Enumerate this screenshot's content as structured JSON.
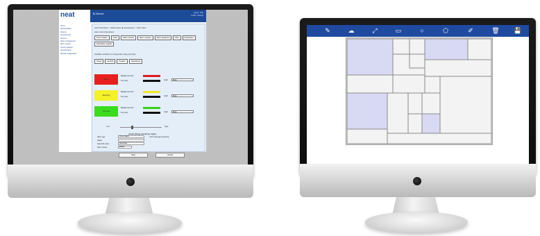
{
  "left_screen": {
    "logo": "neat",
    "header_title": "B-Server",
    "header_links": [
      "Logout",
      "Help",
      "Profile",
      "Settings"
    ],
    "nav_items": [
      "Home",
      "Administration",
      "Options",
      "Users/Groups",
      "Devices",
      "Alarm management",
      "Alarm system",
      "System settings",
      "Administration",
      "Manual configuration"
    ],
    "top_text": "Alarm/Call Status  ○ Default Alarm  ◉ Special alarm  ○ Other alarm",
    "sub_text": "Alarm call configurations",
    "buttons_row1": [
      "Time of alarm",
      "Color",
      "Alarm sounds",
      "Alarm manuav",
      "Alarm telephone",
      "Plan",
      "Destination"
    ],
    "buttons_row2": [
      "Destination register"
    ],
    "mid_text": "Available variables for configuration (drag and drop)",
    "buttons_row3": [
      "Group",
      "Zone/ID",
      "Position",
      "Operational"
    ],
    "alarm_rows": [
      {
        "name": "Alarm",
        "color": "#e82020",
        "bg_label": "Background color",
        "text_label": "Text color",
        "bar1": "#e21b1b",
        "bar2": "#111111"
      },
      {
        "name": "Warning",
        "color": "#f4f127",
        "bg_label": "Background color",
        "text_label": "Text color",
        "bar1": "#f0ea20",
        "bar2": "#111111"
      },
      {
        "name": "Normal",
        "color": "#3cdb20",
        "bg_label": "Background color",
        "text_label": "Text color",
        "bar1": "#35d21e",
        "bar2": "#111111"
      }
    ],
    "audio_label": "Audio",
    "audio_select": "None",
    "slider_low": "Low",
    "slider_high": "High",
    "audio_section_title": "Audio (Drag and Drop style)",
    "form_rows": [
      {
        "label": "Alarm type",
        "value": "Time of alarm"
      },
      {
        "label": "Status",
        "value": ""
      },
      {
        "label": "Sound file name",
        "value": "Result.wav"
      },
      {
        "label": "Alarm volume",
        "value": "Enable"
      }
    ],
    "radio_text": "○ Short delay  ◉ Long lasting",
    "save_label": "Save",
    "cancel_label": "Cancel"
  },
  "right_screen": {
    "toolbar_icons": [
      "edit-icon",
      "upload-icon",
      "resize-icon",
      "rectangle-icon",
      "circle-icon",
      "polygon-icon",
      "brush-icon",
      "trash-icon",
      "save-icon"
    ],
    "toolbar_glyphs": [
      "✎",
      "☁",
      "⤢",
      "▭",
      "○",
      "⬠",
      "✐",
      "🗑",
      "💾"
    ],
    "highlight_color": "#d8d9f3",
    "toolbar_color": "#1f4aa0"
  }
}
